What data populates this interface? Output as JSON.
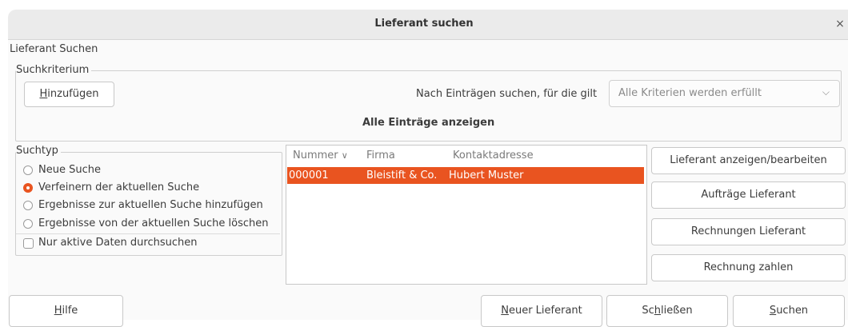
{
  "window": {
    "title": "Lieferant suchen",
    "close": "×"
  },
  "page_label": "Lieferant Suchen",
  "criteria": {
    "legend": "Suchkriterium",
    "add_prefix": "H",
    "add_rest": "inzufügen",
    "match_label": "Nach Einträgen suchen, für die gilt",
    "match_value": "Alle Kriterien werden erfüllt",
    "show_all": "Alle Einträge anzeigen"
  },
  "search_type": {
    "legend": "Suchtyp",
    "options": [
      "Neue Suche",
      "Verfeinern der aktuellen Suche",
      "Ergebnisse zur aktuellen Suche hinzufügen",
      "Ergebnisse von der aktuellen Suche löschen"
    ],
    "selected_index": 1,
    "only_active": "Nur aktive Daten durchsuchen"
  },
  "results": {
    "columns": [
      "Nummer",
      "Firma",
      "Kontaktadresse"
    ],
    "sort_indicator": "∨",
    "rows": [
      {
        "nummer": "000001",
        "firma": "Bleistift & Co.",
        "kontakt": "Hubert Muster"
      }
    ]
  },
  "actions": [
    "Lieferant anzeigen/bearbeiten",
    "Aufträge Lieferant",
    "Rechnungen Lieferant",
    "Rechnung zahlen"
  ],
  "footer": {
    "help_prefix": "H",
    "help_rest": "ilfe",
    "new_prefix": "N",
    "new_rest": "euer Lieferant",
    "close_prefix": "Sc",
    "close_mid": "h",
    "close_rest": "ließen",
    "search_prefix": "S",
    "search_rest": "uchen"
  },
  "colors": {
    "accent": "#e95420"
  }
}
